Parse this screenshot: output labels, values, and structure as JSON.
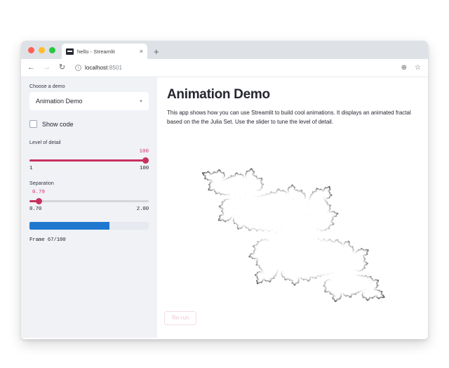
{
  "browser": {
    "tab": {
      "title": "hello - Streamlit",
      "favicon_name": "streamlit-favicon",
      "close_label": "×"
    },
    "new_tab_label": "+",
    "nav": {
      "back_label": "←",
      "forward_label": "→",
      "reload_label": "↻"
    },
    "omnibox": {
      "info_label": "i",
      "host": "localhost",
      "port": ":8501"
    },
    "right_icons": {
      "zoom_label": "⊕",
      "bookmark_label": "☆"
    }
  },
  "sidebar": {
    "demo_label": "Choose a demo",
    "demo_selected": "Animation Demo",
    "demo_chevron": "▾",
    "show_code_label": "Show code",
    "show_code_checked": false,
    "level_of_detail": {
      "label": "Level of detail",
      "value": "100",
      "min_label": "1",
      "max_label": "100",
      "fill_percent": 100,
      "thumb_percent": 100
    },
    "separation": {
      "label": "Separation",
      "value": "0.79",
      "min_label": "0.70",
      "max_label": "2.00",
      "fill_percent": 7,
      "thumb_percent": 7
    },
    "progress": {
      "percent": 67,
      "status": "Frame 67/100"
    }
  },
  "main": {
    "title": "Animation Demo",
    "description": "This app shows how you can use Streamlit to build cool animations. It displays an animated fractal based on the the Julia Set. Use the slider to tune the level of detail.",
    "rerun_label": "Re-run"
  },
  "colors": {
    "slider_accent": "#c9305e",
    "slider_value_text": "#d6336c",
    "progress_fill": "#1f77d0",
    "sidebar_bg": "#f0f2f6",
    "text": "#262730"
  }
}
